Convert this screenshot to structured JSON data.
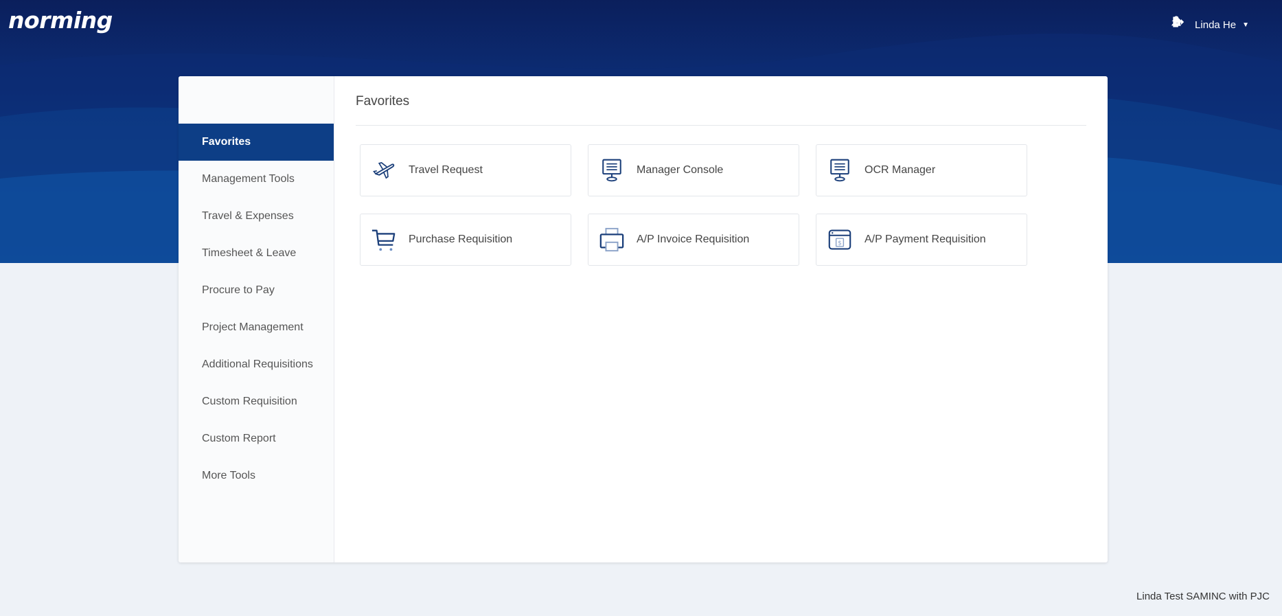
{
  "brand": {
    "logo_text": "norming"
  },
  "topnav": {
    "user_name": "Linda He"
  },
  "sidebar": {
    "items": [
      {
        "label": "Favorites",
        "active": true
      },
      {
        "label": "Management Tools"
      },
      {
        "label": "Travel & Expenses"
      },
      {
        "label": "Timesheet & Leave"
      },
      {
        "label": "Procure to Pay"
      },
      {
        "label": "Project Management"
      },
      {
        "label": "Additional Requisitions"
      },
      {
        "label": "Custom Requisition"
      },
      {
        "label": "Custom Report"
      },
      {
        "label": "More Tools"
      }
    ]
  },
  "main": {
    "title": "Favorites",
    "tiles": [
      {
        "label": "Travel Request",
        "icon": "airplane-icon"
      },
      {
        "label": "Manager Console",
        "icon": "monitor-icon"
      },
      {
        "label": "OCR Manager",
        "icon": "monitor-icon"
      },
      {
        "label": "Purchase Requisition",
        "icon": "cart-icon"
      },
      {
        "label": "A/P Invoice Requisition",
        "icon": "printer-icon"
      },
      {
        "label": "A/P Payment Requisition",
        "icon": "payment-icon"
      }
    ]
  },
  "footer": {
    "text": "Linda Test SAMINC with PJC"
  },
  "colors": {
    "header_dark": "#0b1f5c",
    "header_light": "#0f56a8",
    "active_nav": "#0d3e86",
    "icon": "#1b3f7a",
    "page_bg": "#eef2f7"
  }
}
